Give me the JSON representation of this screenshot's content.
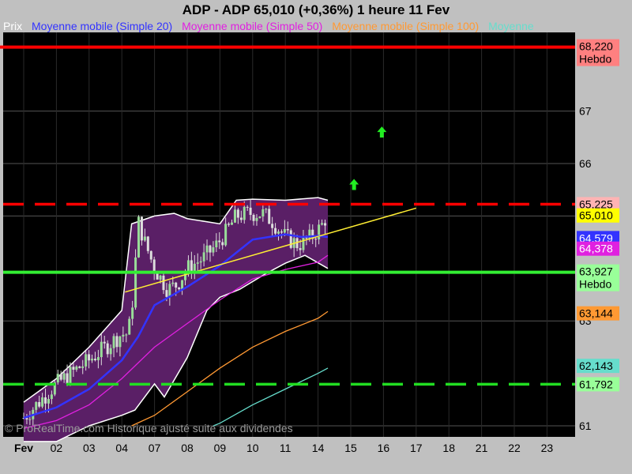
{
  "header": {
    "title": "ADP - ADP      65,010 (+0,36%)    1 heure  11 Fev"
  },
  "legend": {
    "items": [
      {
        "label": "Prix",
        "color": "#ffffff"
      },
      {
        "label": "Moyenne mobile (Simple 20)",
        "color": "#3333ff"
      },
      {
        "label": "Moyenne mobile (Simple 50)",
        "color": "#e020e0"
      },
      {
        "label": "Moyenne mobile (Simple 100)",
        "color": "#ff9933"
      },
      {
        "label": "Moyenne",
        "color": "#66ddcc"
      }
    ]
  },
  "watermark": "© ProRealTime.com Historique ajusté suite aux dividendes",
  "chart_data": {
    "type": "line",
    "title": "ADP - ADP 65,010 (+0,36%) 1 heure 11 Fev",
    "x_categories": [
      "Fev",
      "02",
      "03",
      "04",
      "07",
      "08",
      "09",
      "10",
      "11",
      "14",
      "15",
      "16",
      "17",
      "18",
      "21",
      "22",
      "23"
    ],
    "y_ticks": [
      "61",
      "63",
      "65",
      "66",
      "67"
    ],
    "ylim": [
      61,
      68.35
    ],
    "grid": true,
    "legend_position": "top-left",
    "last_price": 65.01,
    "price_path": [
      [
        0,
        61.15
      ],
      [
        1,
        61.8
      ],
      [
        2,
        62.25
      ],
      [
        3,
        62.75
      ],
      [
        3.2,
        62.75
      ],
      [
        3.35,
        63.5
      ],
      [
        3.5,
        64.9
      ],
      [
        3.7,
        64.5
      ],
      [
        4,
        64.0
      ],
      [
        4.4,
        63.6
      ],
      [
        4.7,
        63.7
      ],
      [
        5,
        64.0
      ],
      [
        5.5,
        64.2
      ],
      [
        5.9,
        64.45
      ],
      [
        6.2,
        64.7
      ],
      [
        6.5,
        65.0
      ],
      [
        6.9,
        65.05
      ],
      [
        7.3,
        65.05
      ],
      [
        7.6,
        64.9
      ],
      [
        8,
        64.6
      ],
      [
        8.4,
        64.45
      ],
      [
        8.8,
        64.6
      ],
      [
        9.1,
        64.8
      ],
      [
        9.3,
        65.05
      ]
    ],
    "series": [
      {
        "name": "Moyenne mobile (Simple 20)",
        "color": "#3333ff",
        "points": [
          [
            0,
            61.15
          ],
          [
            1,
            61.35
          ],
          [
            2,
            61.7
          ],
          [
            3,
            62.25
          ],
          [
            3.5,
            62.7
          ],
          [
            4,
            63.3
          ],
          [
            5,
            63.65
          ],
          [
            6,
            64.05
          ],
          [
            6.5,
            64.3
          ],
          [
            7,
            64.55
          ],
          [
            8,
            64.65
          ],
          [
            8.5,
            64.6
          ],
          [
            9,
            64.62
          ],
          [
            9.3,
            64.6
          ]
        ]
      },
      {
        "name": "Moyenne mobile (Simple 50)",
        "color": "#e020e0",
        "points": [
          [
            0,
            60.95
          ],
          [
            1,
            61.1
          ],
          [
            2,
            61.4
          ],
          [
            3,
            61.9
          ],
          [
            4,
            62.5
          ],
          [
            5,
            62.95
          ],
          [
            6,
            63.4
          ],
          [
            7,
            63.8
          ],
          [
            8,
            63.98
          ],
          [
            9,
            64.12
          ],
          [
            9.3,
            64.25
          ]
        ]
      },
      {
        "name": "Moyenne mobile (Simple 100)",
        "color": "#ff9933",
        "points": [
          [
            3.3,
            61.0
          ],
          [
            4,
            61.2
          ],
          [
            5,
            61.65
          ],
          [
            6,
            62.1
          ],
          [
            7,
            62.5
          ],
          [
            8,
            62.8
          ],
          [
            9,
            63.05
          ],
          [
            9.3,
            63.18
          ]
        ]
      },
      {
        "name": "Moyenne",
        "color": "#66ddcc",
        "points": [
          [
            5.8,
            61.0
          ],
          [
            6,
            61.05
          ],
          [
            7,
            61.4
          ],
          [
            8,
            61.7
          ],
          [
            9,
            62.0
          ],
          [
            9.3,
            62.1
          ]
        ]
      }
    ],
    "bollinger": {
      "upper": [
        [
          0,
          61.45
        ],
        [
          1,
          61.9
        ],
        [
          2,
          62.5
        ],
        [
          3,
          63.2
        ],
        [
          3.3,
          64.85
        ],
        [
          4,
          65.0
        ],
        [
          4.6,
          65.05
        ],
        [
          5,
          64.95
        ],
        [
          6,
          64.85
        ],
        [
          6.5,
          65.3
        ],
        [
          7,
          65.32
        ],
        [
          8,
          65.3
        ],
        [
          9,
          65.35
        ],
        [
          9.3,
          65.3
        ]
      ],
      "lower": [
        [
          9.3,
          64.0
        ],
        [
          8.6,
          64.25
        ],
        [
          8,
          64.1
        ],
        [
          7.4,
          63.9
        ],
        [
          7,
          63.75
        ],
        [
          6.6,
          63.6
        ],
        [
          6,
          63.45
        ],
        [
          5.6,
          63.2
        ],
        [
          5,
          62.3
        ],
        [
          4.3,
          61.55
        ],
        [
          4,
          61.8
        ],
        [
          3.4,
          61.3
        ],
        [
          3,
          61.2
        ],
        [
          2,
          61.0
        ],
        [
          1,
          60.7
        ],
        [
          0,
          60.7
        ]
      ]
    },
    "horizontal_levels": [
      {
        "value": 68.22,
        "label": "68,220",
        "sublabel": "Hebdo",
        "color": "#ff0000",
        "style": "solid",
        "label_bg": "#ff8080"
      },
      {
        "value": 65.225,
        "label": "65,225",
        "color": "#ff0000",
        "style": "dashed",
        "label_bg": "#ffb3b3"
      },
      {
        "value": 63.927,
        "label": "63,927",
        "sublabel": "Hebdo",
        "color": "#33ee33",
        "style": "solid",
        "label_bg": "#99ff99"
      },
      {
        "value": 61.792,
        "label": "61,792",
        "color": "#22dd22",
        "style": "dashed",
        "label_bg": "#99ff99"
      }
    ],
    "price_labels": [
      {
        "value": 65.01,
        "label": "65,010",
        "bg": "#ffff00"
      },
      {
        "value": 64.579,
        "label": "64,579",
        "bg": "#3333ff"
      },
      {
        "value": 64.378,
        "label": "64,378",
        "bg": "#e020e0"
      },
      {
        "value": 63.144,
        "label": "63,144",
        "bg": "#ff9933"
      },
      {
        "value": 62.143,
        "label": "62,143",
        "bg": "#66ddcc"
      }
    ],
    "trendline": {
      "from": [
        3.1,
        63.55
      ],
      "to": [
        12.0,
        65.15
      ],
      "color": "#ffee33"
    },
    "arrows": [
      {
        "x": 10.1,
        "y": 65.6
      },
      {
        "x": 10.95,
        "y": 66.6
      }
    ]
  }
}
